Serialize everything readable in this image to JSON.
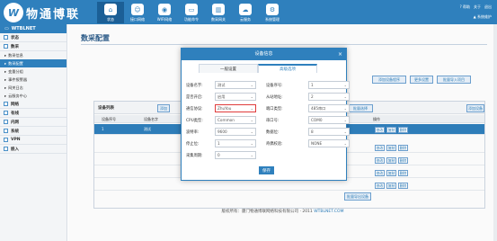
{
  "brand": {
    "logo_letter": "W",
    "name": "物通博联"
  },
  "nav": [
    {
      "label": "状态",
      "icon": "⌂",
      "active": true
    },
    {
      "label": "接口网络",
      "icon": "☺"
    },
    {
      "label": "WIFI网络",
      "icon": "◉"
    },
    {
      "label": "功能命令",
      "icon": "▭"
    },
    {
      "label": "数采网关",
      "icon": "▥"
    },
    {
      "label": "云服务",
      "icon": "☁"
    },
    {
      "label": "系统管理",
      "icon": "⚙"
    }
  ],
  "topright": {
    "help": "? 帮助",
    "about": "关于",
    "logout": "退出",
    "user": "▲ 系统维护"
  },
  "sidebar": {
    "header": "WTBLNET",
    "sections": [
      {
        "label": "状态"
      },
      {
        "label": "数采",
        "subs": [
          "数采信息",
          "数采配置",
          "变量分组",
          "事件报警器",
          "网关日志",
          "云服务中心"
        ]
      },
      {
        "label": "网络"
      },
      {
        "label": "有线"
      },
      {
        "label": "内网"
      },
      {
        "label": "系统"
      },
      {
        "label": "VPN"
      },
      {
        "label": "嵌入"
      }
    ],
    "active_sub": "数采配置"
  },
  "page": {
    "title": "数采配置"
  },
  "top_buttons": [
    "添加设备程序",
    "更多设置",
    "批量导入项目"
  ],
  "panel": {
    "title": "设备列表",
    "head_buttons": [
      "添加",
      "批量选择",
      "添加设备"
    ],
    "columns": [
      "设备序号",
      "设备名字",
      "操作"
    ],
    "rows": [
      {
        "no": "1",
        "name": "测试",
        "ops": [
          "修改",
          "复制",
          "删除"
        ]
      }
    ],
    "extra_rows": [
      {
        "ops": [
          "修改",
          "复制",
          "删除"
        ]
      },
      {
        "ops": [
          "修改",
          "复制",
          "删除"
        ]
      },
      {
        "ops": [
          "修改",
          "复制",
          "删除"
        ]
      },
      {
        "ops": [
          "修改",
          "复制",
          "删除"
        ]
      }
    ],
    "bottom_btn": "批量导出设备"
  },
  "dialog": {
    "title": "设备信息",
    "close": "×",
    "tabs": [
      "一般设置",
      "高级选项"
    ],
    "fields_left": [
      {
        "label": "设备名字:",
        "value": "测试"
      },
      {
        "label": "是否开启:",
        "value": "启用"
      },
      {
        "label": "通信协议:",
        "value": "ZhuYou",
        "red": true
      },
      {
        "label": "CPU类型:",
        "value": "Common"
      },
      {
        "label": "波特率:",
        "value": "9600"
      },
      {
        "label": "停止位:",
        "value": "1"
      },
      {
        "label": "采集周期:",
        "value": "0"
      }
    ],
    "fields_right": [
      {
        "label": "设备序号:",
        "value": "1"
      },
      {
        "label": "从站地址:",
        "value": "2"
      },
      {
        "label": "端口类型:",
        "value": "485串口"
      },
      {
        "label": "串口号:",
        "value": "COM0"
      },
      {
        "label": "数据位:",
        "value": "8"
      },
      {
        "label": "奇偶校验:",
        "value": "NONE"
      }
    ],
    "save": "保存"
  },
  "footer": {
    "text": "版权所有：厦门物通博联网络科技有限公司 · 2011",
    "brand": "WTBLNET.COM"
  }
}
